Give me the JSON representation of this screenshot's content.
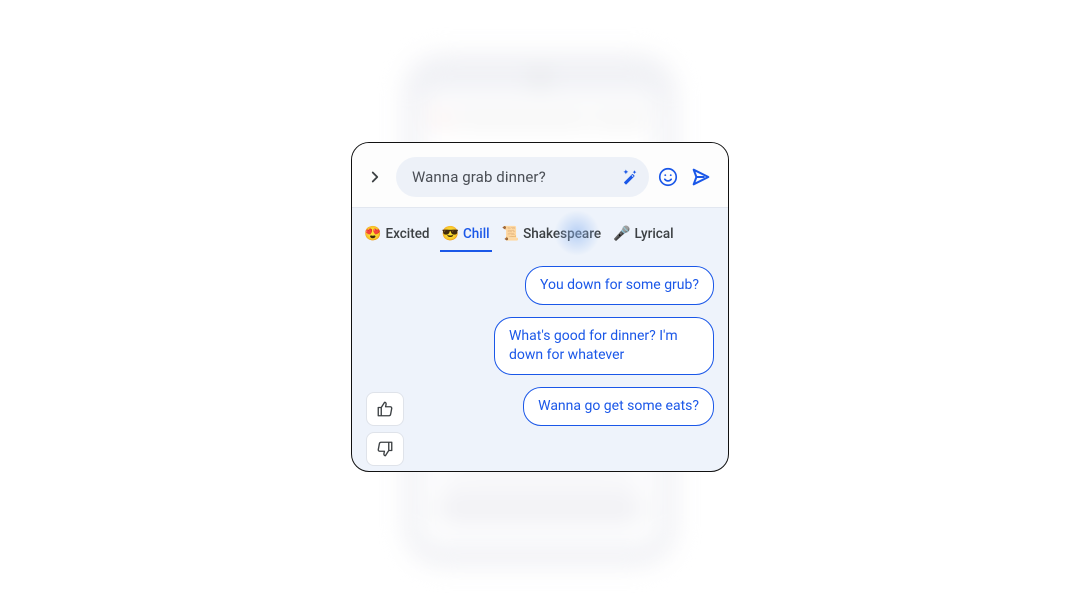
{
  "input": {
    "value": "Wanna grab dinner?"
  },
  "tabs": [
    {
      "emoji": "😍",
      "label": "Excited",
      "active": false
    },
    {
      "emoji": "😎",
      "label": "Chill",
      "active": true
    },
    {
      "emoji": "📜",
      "label": "Shakespeare",
      "active": false
    },
    {
      "emoji": "🎤",
      "label": "Lyrical",
      "active": false
    }
  ],
  "suggestions": [
    "You down for some grub?",
    "What's good for dinner? I'm down for whatever",
    "Wanna go get some eats?"
  ],
  "icons": {
    "expand": "chevron-right",
    "magic": "magic-wand",
    "emoji": "smiley",
    "send": "send",
    "thumbs_up": "thumbs-up",
    "thumbs_down": "thumbs-down"
  },
  "colors": {
    "accent": "#1a57e8",
    "card_bg": "#eef3fb",
    "pill_bg": "#edf1f8"
  }
}
